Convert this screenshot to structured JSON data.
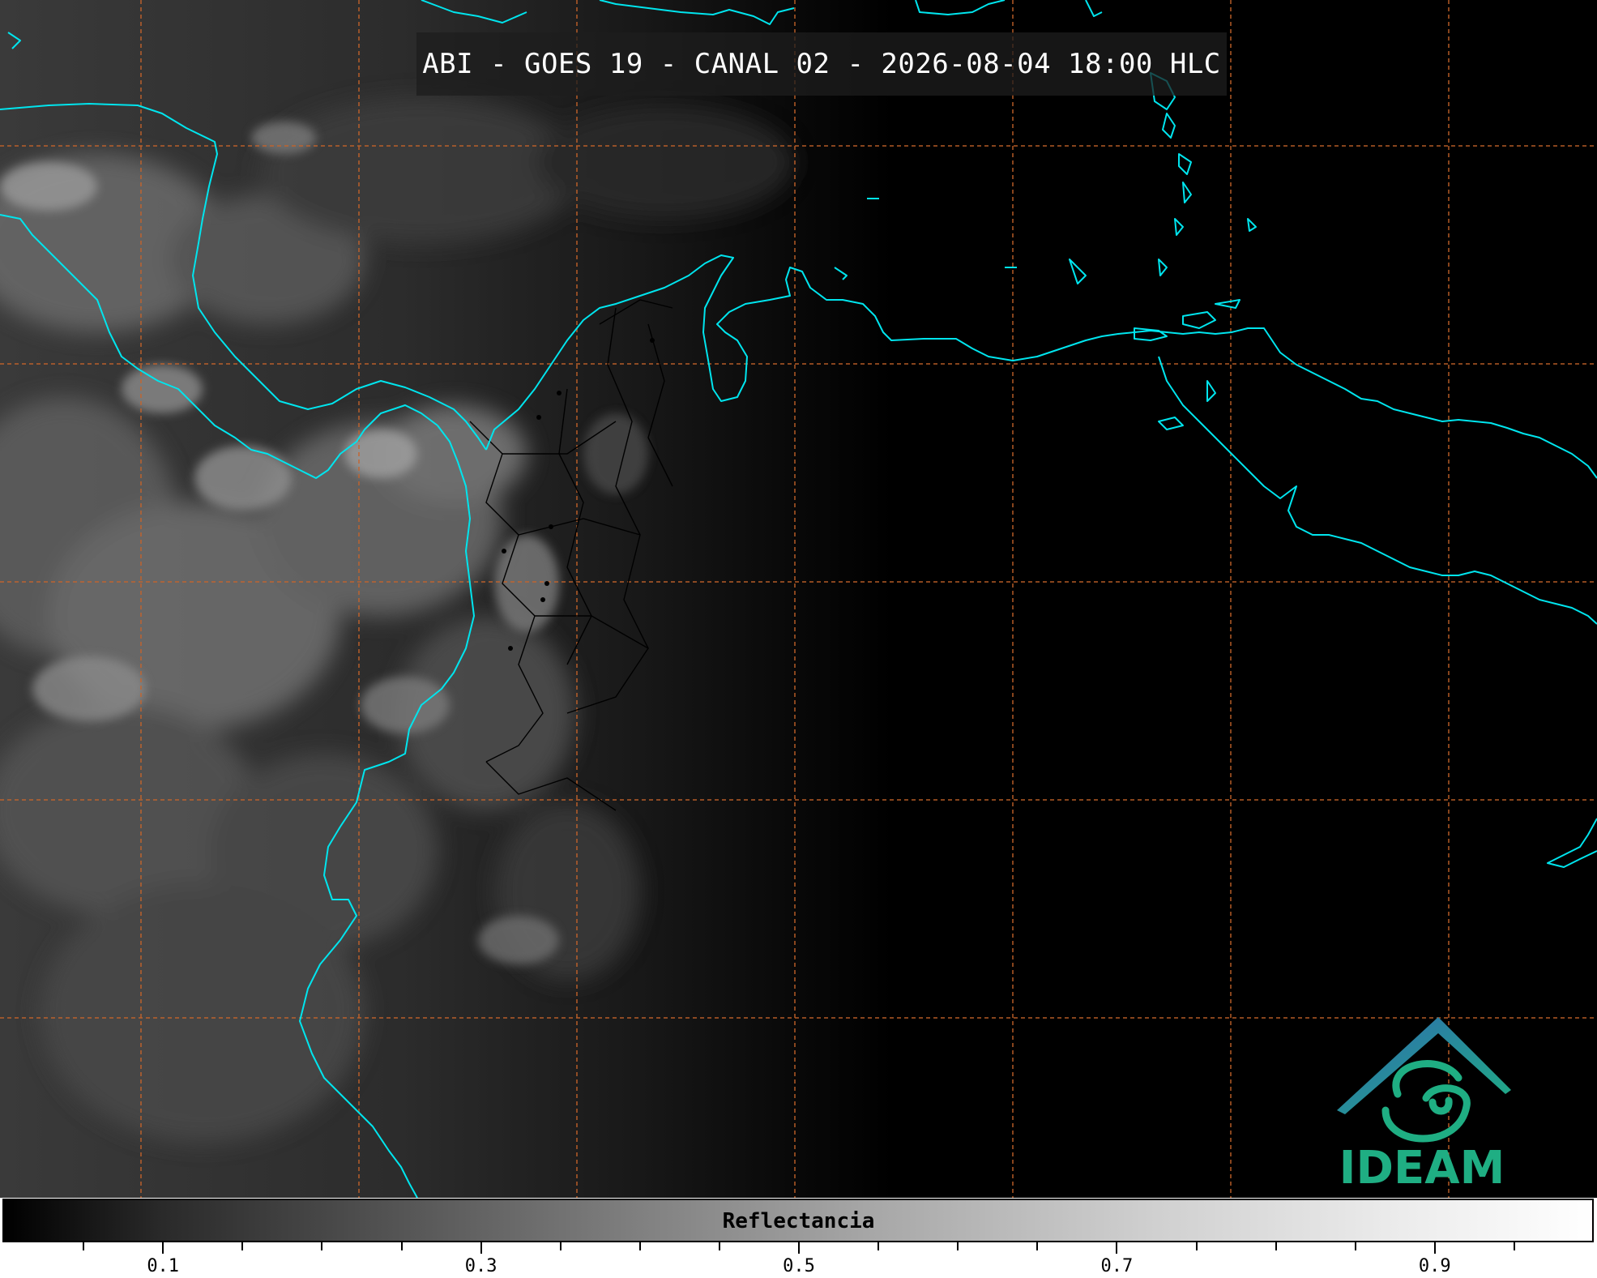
{
  "title": "ABI - GOES 19 - CANAL 02 - 2026-08-04 18:00 HLC",
  "logo": {
    "text": "IDEAM",
    "colors": {
      "teal": "#1fae83",
      "blue": "#2f6bb0"
    }
  },
  "colorbar": {
    "label": "Reflectancia",
    "range": [
      0,
      1
    ],
    "tick_labels": [
      "0.1",
      "0.3",
      "0.5",
      "0.7",
      "0.9"
    ],
    "tick_values": [
      0.1,
      0.3,
      0.5,
      0.7,
      0.9
    ],
    "minor_tick_step": 0.05,
    "colormap": "grayscale (black to white)"
  },
  "map": {
    "coastline_color": "#00e5ee",
    "borders_color": "#000000",
    "grid_color": "#c8642a",
    "grid_style": "dashed"
  }
}
